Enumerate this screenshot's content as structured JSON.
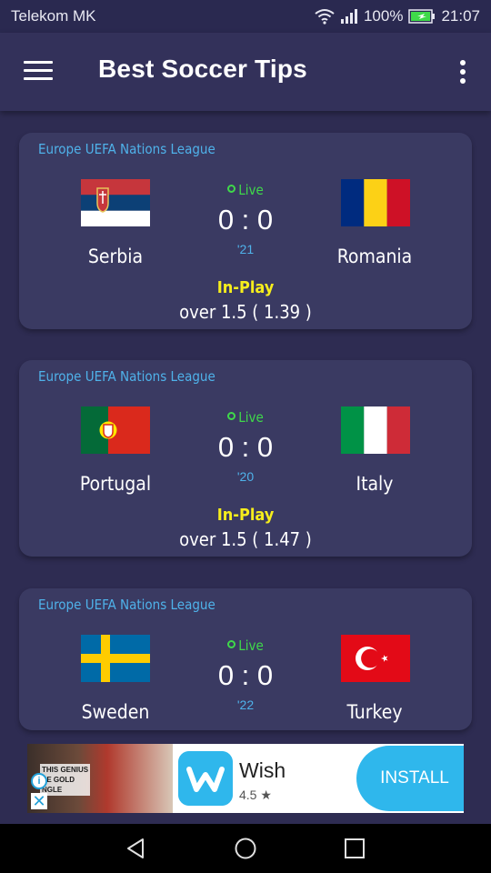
{
  "status_bar": {
    "carrier": "Telekom MK",
    "battery": "100%",
    "time": "21:07"
  },
  "app_bar": {
    "title": "Best Soccer Tips"
  },
  "matches": [
    {
      "league": "Europe UEFA Nations League",
      "home": "Serbia",
      "away": "Romania",
      "status": "Live",
      "score": "0 : 0",
      "minute": "'21",
      "phase": "In-Play",
      "tip": "over 1.5  ( 1.39 )"
    },
    {
      "league": "Europe UEFA Nations League",
      "home": "Portugal",
      "away": "Italy",
      "status": "Live",
      "score": "0 : 0",
      "minute": "'20",
      "phase": "In-Play",
      "tip": "over 1.5  ( 1.47 )"
    },
    {
      "league": "Europe UEFA Nations League",
      "home": "Sweden",
      "away": "Turkey",
      "status": "Live",
      "score": "0 : 0",
      "minute": "'22"
    }
  ],
  "ad": {
    "photo_text": "THIS GENIUS\nSE GOLD\nNGLE",
    "app_name": "Wish",
    "rating": "4.5 ★",
    "install_label": "INSTALL"
  },
  "colors": {
    "background": "#2e2c52",
    "card": "#3a3a62",
    "league_text": "#4fb2ea",
    "live": "#3fd94a",
    "in_play": "#f6ee1c",
    "ad_accent": "#2fb7ec"
  }
}
